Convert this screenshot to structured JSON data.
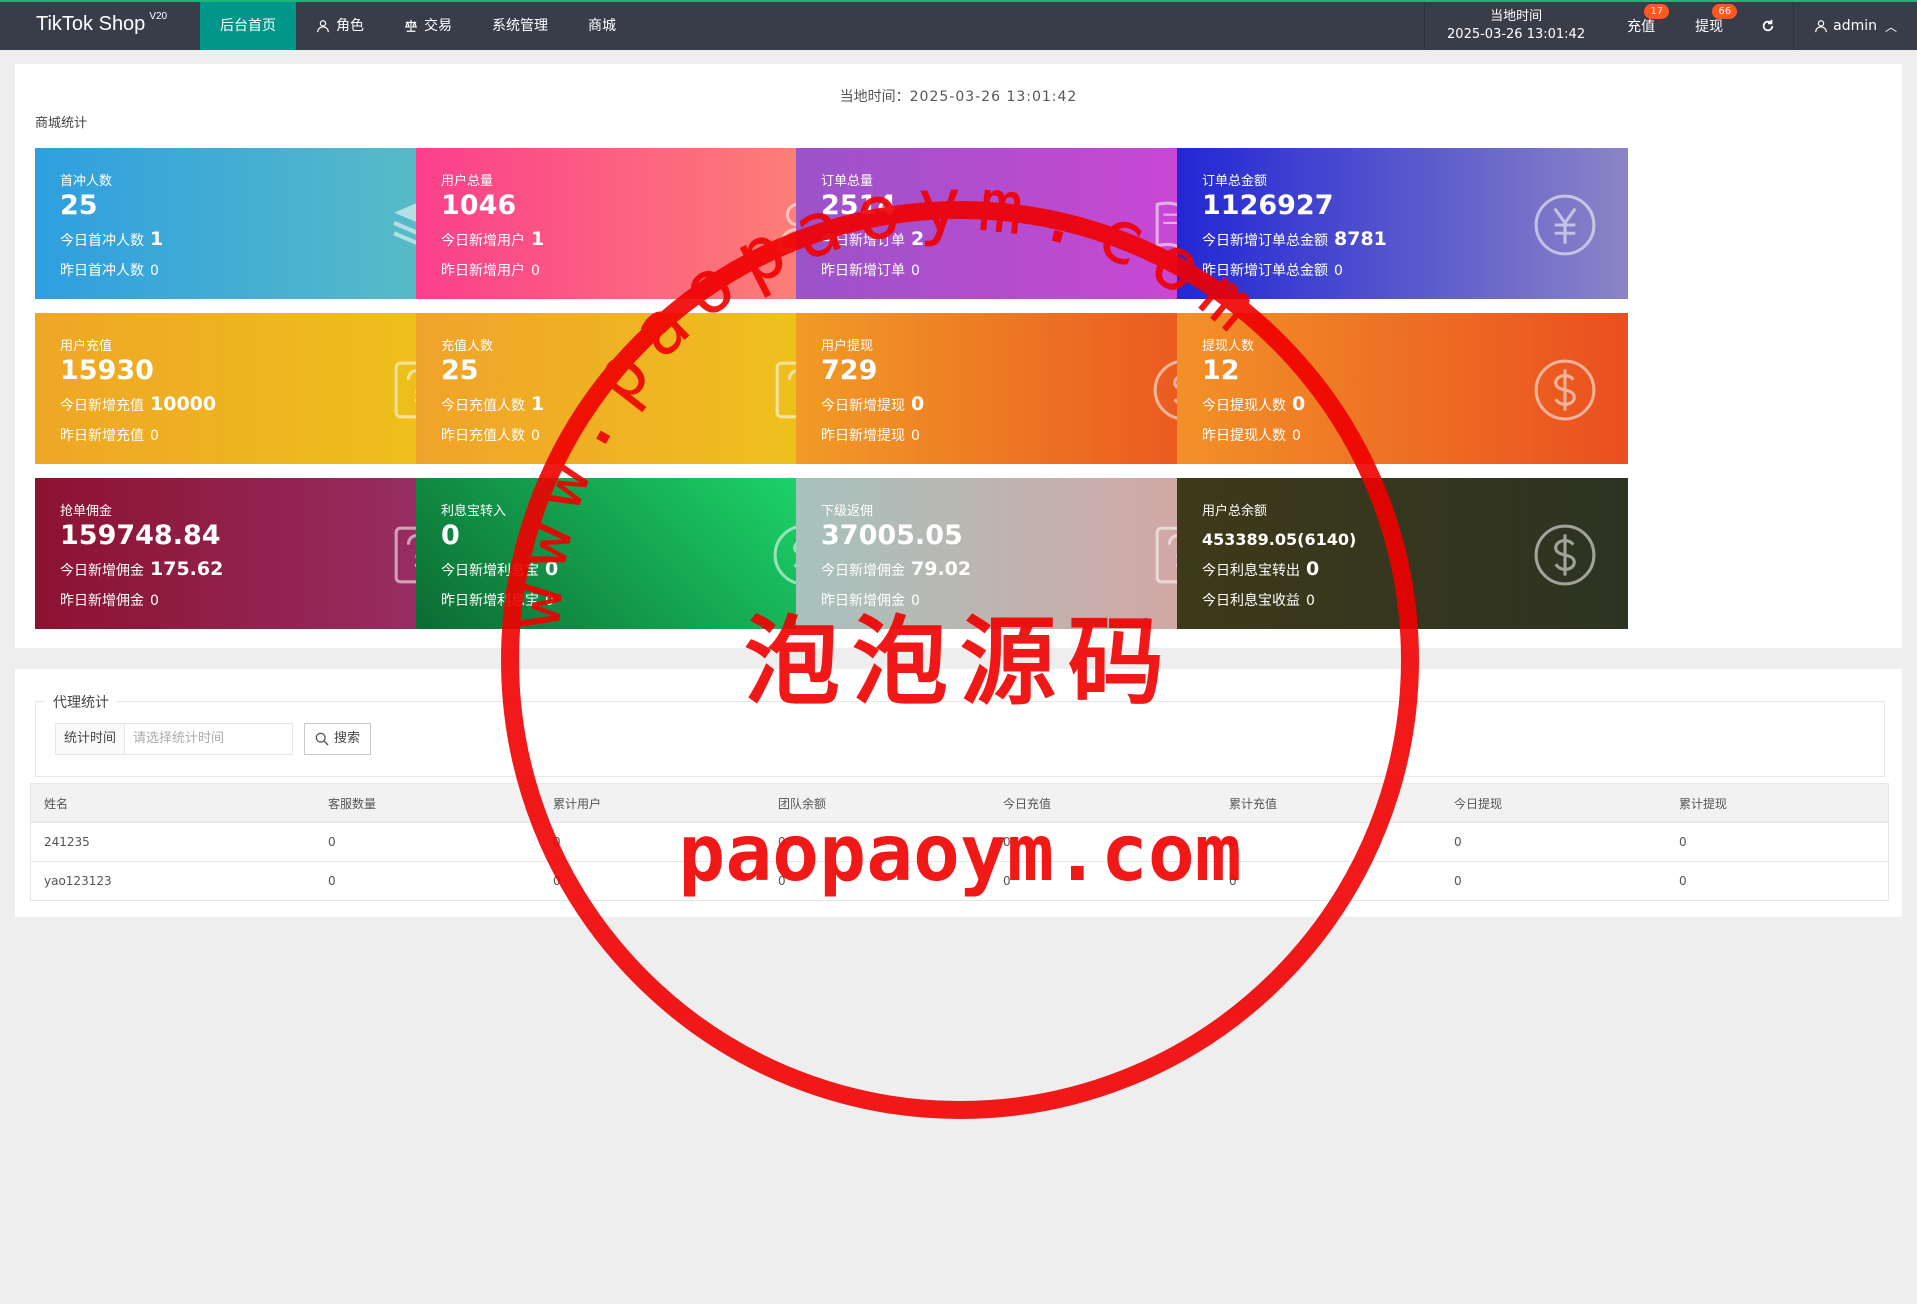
{
  "header": {
    "logo": "TikTok Shop",
    "logo_version": "V20",
    "nav": [
      {
        "label": "后台首页",
        "active": true
      },
      {
        "label": "角色"
      },
      {
        "label": "交易"
      },
      {
        "label": "系统管理"
      },
      {
        "label": "商城"
      }
    ],
    "time_label": "当地时间",
    "time_value": "2025-03-26 13:01:42",
    "recharge": "充值",
    "recharge_badge": "17",
    "withdraw": "提现",
    "withdraw_badge": "66",
    "user": "admin"
  },
  "stats": {
    "local_time_label": "当地时间：",
    "local_time_value": "2025-03-26 13:01:42",
    "section_title": "商城统计",
    "cards": [
      {
        "label": "首冲人数",
        "value": "25",
        "line1": "今日首冲人数",
        "line1_val": "1",
        "line2": "昨日首冲人数",
        "line2_val": "0",
        "icon": "layers-icon"
      },
      {
        "label": "用户总量",
        "value": "1046",
        "line1": "今日新增用户",
        "line1_val": "1",
        "line2": "昨日新增用户",
        "line2_val": "0",
        "icon": "users-icon"
      },
      {
        "label": "订单总量",
        "value": "2514",
        "line1": "今日新增订单",
        "line1_val": "2",
        "line2": "昨日新增订单",
        "line2_val": "0",
        "icon": "book-icon"
      },
      {
        "label": "订单总金额",
        "value": "1126927",
        "line1": "今日新增订单总金额",
        "line1_val": "8781",
        "line2": "昨日新增订单总金额",
        "line2_val": "0",
        "icon": "yen-icon"
      },
      {
        "label": "用户充值",
        "value": "15930",
        "line1": "今日新增充值",
        "line1_val": "10000",
        "line2": "昨日新增充值",
        "line2_val": "0",
        "icon": "question-edit-icon"
      },
      {
        "label": "充值人数",
        "value": "25",
        "line1": "今日充值人数",
        "line1_val": "1",
        "line2": "昨日充值人数",
        "line2_val": "0",
        "icon": "question-edit-icon"
      },
      {
        "label": "用户提现",
        "value": "729",
        "line1": "今日新增提现",
        "line1_val": "0",
        "line2": "昨日新增提现",
        "line2_val": "0",
        "icon": "dollar-icon"
      },
      {
        "label": "提现人数",
        "value": "12",
        "line1": "今日提现人数",
        "line1_val": "0",
        "line2": "昨日提现人数",
        "line2_val": "0",
        "icon": "dollar-icon"
      },
      {
        "label": "抢单佣金",
        "value": "159748.84",
        "line1": "今日新增佣金",
        "line1_val": "175.62",
        "line2": "昨日新增佣金",
        "line2_val": "0",
        "icon": "question-edit-icon"
      },
      {
        "label": "利息宝转入",
        "value": "0",
        "line1": "今日新增利息宝",
        "line1_val": "0",
        "line2": "昨日新增利息宝",
        "line2_val": "0",
        "icon": "dollar-icon"
      },
      {
        "label": "下级返佣",
        "value": "37005.05",
        "line1": "今日新增佣金",
        "line1_val": "79.02",
        "line2": "昨日新增佣金",
        "line2_val": "0",
        "icon": "question-edit-icon"
      },
      {
        "label": "用户总余额",
        "value": "453389.05(6140)",
        "line1": "今日利息宝转出",
        "line1_val": "0",
        "line2": "今日利息宝收益",
        "line2_val": "0",
        "icon": "dollar-icon"
      }
    ]
  },
  "agent": {
    "legend": "代理统计",
    "search_label": "统计时间",
    "search_placeholder": "请选择统计时间",
    "search_button": "搜索",
    "columns": [
      "姓名",
      "客服数量",
      "累计用户",
      "团队余额",
      "今日充值",
      "累计充值",
      "今日提现",
      "累计提现"
    ],
    "rows": [
      [
        "241235",
        "0",
        "0",
        "0",
        "0",
        "0",
        "0",
        "0"
      ],
      [
        "yao123123",
        "0",
        "0",
        "0",
        "0",
        "0",
        "0",
        "0"
      ]
    ]
  },
  "watermark": {
    "arc_text": "www.paopaoym.com",
    "center_text": "泡泡源码",
    "bottom_text": "paopaoym.com",
    "color": "#f00000"
  }
}
